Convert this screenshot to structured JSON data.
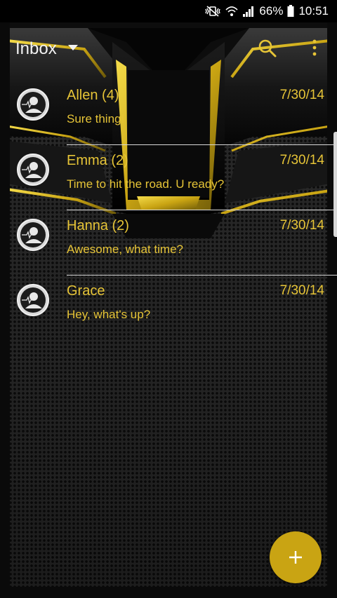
{
  "status_bar": {
    "battery": "66%",
    "time": "10:51",
    "icons": [
      "mute-vibrate-icon",
      "wifi-icon",
      "signal-icon",
      "battery-icon"
    ]
  },
  "app_bar": {
    "title": "Inbox",
    "icons": [
      "dropdown-caret-icon",
      "search-icon",
      "more-vert-icon"
    ]
  },
  "conversations": [
    {
      "name": "Allen (4)",
      "snippet": "Sure thing!",
      "date": "7/30/14"
    },
    {
      "name": "Emma (2)",
      "snippet": "Time to hit the road. U ready?",
      "date": "7/30/14"
    },
    {
      "name": "Hanna (2)",
      "snippet": "Awesome, what time?",
      "date": "7/30/14"
    },
    {
      "name": "Grace",
      "snippet": "Hey, what's up?",
      "date": "7/30/14"
    }
  ],
  "fab": {
    "icon": "plus-icon",
    "symbol": "+"
  },
  "colors": {
    "accent_yellow": "#e6c437",
    "fab": "#c9a413",
    "background": "#2a2a2a",
    "status_bar": "#000000"
  }
}
